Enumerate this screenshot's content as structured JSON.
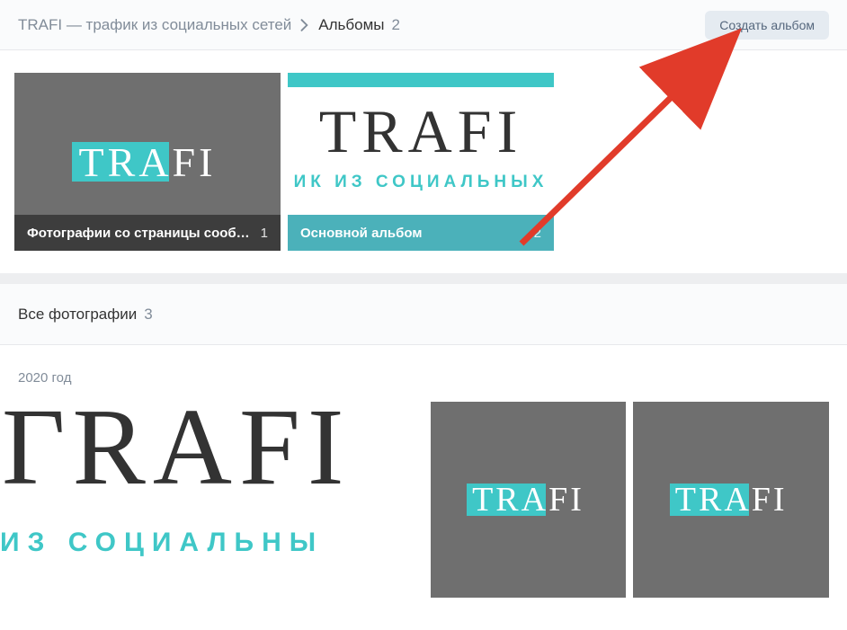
{
  "header": {
    "crumb_root": "TRAFI — трафик из социальных сетей",
    "crumb_current": "Альбомы",
    "crumb_count": "2",
    "create_btn": "Создать альбом"
  },
  "albums": [
    {
      "title": "Фотографии со страницы сообщ…",
      "count": "1",
      "logo_text": "TRAFI"
    },
    {
      "title": "Основной альбом",
      "count": "2",
      "big_text": "TRAFI",
      "sub_text": "ИК ИЗ СОЦИАЛЬНЫХ"
    }
  ],
  "all_photos": {
    "title": "Все фотографии",
    "count": "3",
    "year": "2020 год"
  },
  "photos": {
    "large": {
      "big_text": "ГRAFI",
      "sub_text": "ИЗ СОЦИАЛЬНЫ"
    },
    "small_logo_text": "TRAFI"
  }
}
